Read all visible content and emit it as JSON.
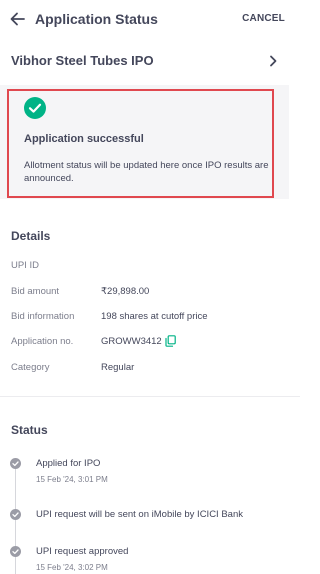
{
  "header": {
    "title": "Application Status",
    "cancel_label": "CANCEL",
    "back_icon": "arrow-left-icon"
  },
  "ipo": {
    "name": "Vibhor Steel Tubes IPO",
    "chevron_icon": "chevron-right-icon"
  },
  "status_card": {
    "icon": "check-circle-icon",
    "heading": "Application successful",
    "description": "Allotment status will be updated here once IPO results are announced.",
    "accent_color": "#00b386",
    "highlight_border_color": "#e0484f"
  },
  "details": {
    "title": "Details",
    "rows": [
      {
        "label": "UPI ID",
        "value": ""
      },
      {
        "label": "Bid amount",
        "value": "₹29,898.00"
      },
      {
        "label": "Bid information",
        "value": "198 shares at cutoff price"
      },
      {
        "label": "Application no.",
        "value": "GROWW3412"
      },
      {
        "label": "Category",
        "value": "Regular"
      }
    ],
    "copy_icon": "copy-icon"
  },
  "status": {
    "title": "Status",
    "steps": [
      {
        "title": "Applied for IPO",
        "time": "15 Feb '24, 3:01 PM"
      },
      {
        "title": "UPI request will be sent on iMobile by ICICI Bank",
        "time": ""
      },
      {
        "title": "UPI request approved",
        "time": "15 Feb '24, 3:02 PM"
      }
    ]
  }
}
